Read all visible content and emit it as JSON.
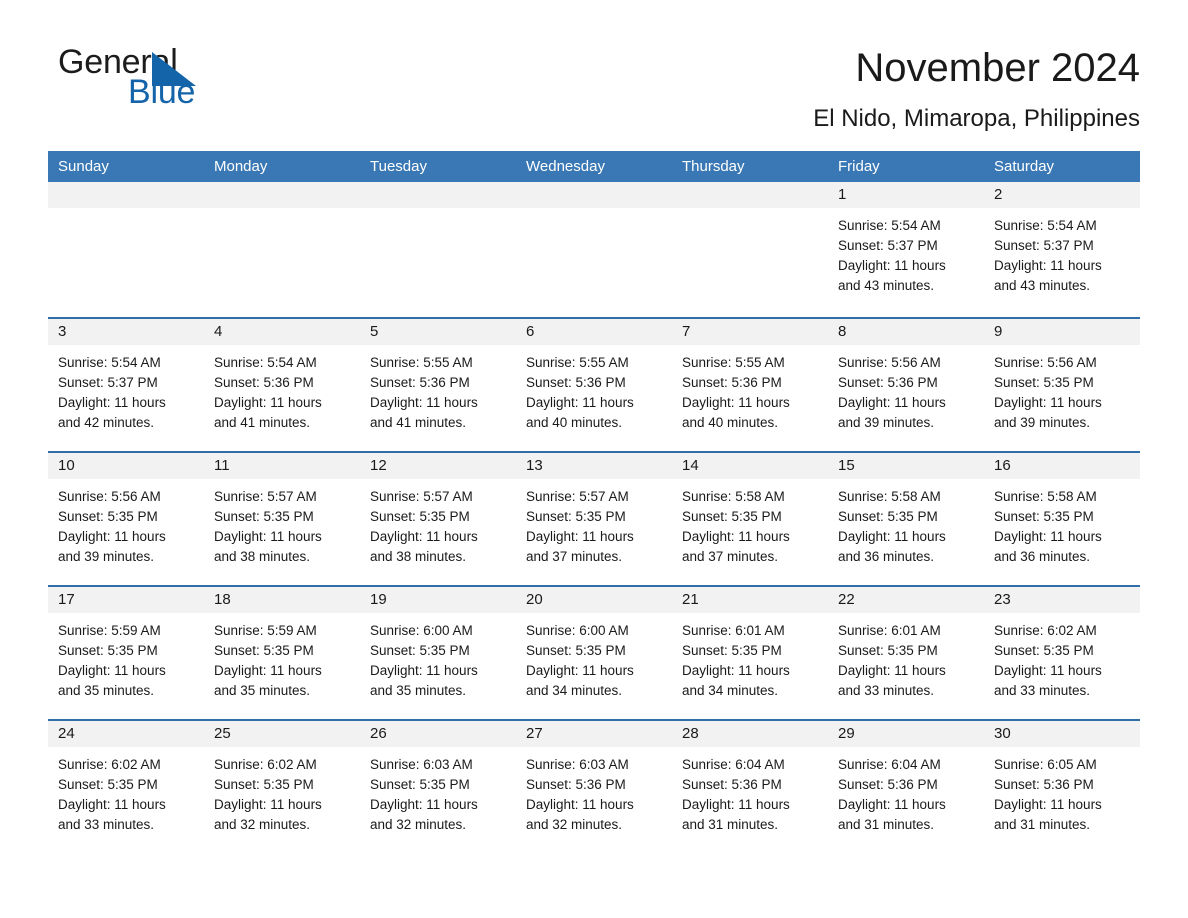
{
  "brand": {
    "word_one": "General",
    "word_two": "Blue",
    "triangle_color": "#1464aa"
  },
  "header": {
    "month_title": "November 2024",
    "location": "El Nido, Mimaropa, Philippines"
  },
  "theme": {
    "header_blue": "#3a78b5",
    "row_rule_blue": "#2f6ea8",
    "day_head_gray": "#f2f2f2",
    "text": "#1a1a1a"
  },
  "weekdays": [
    "Sunday",
    "Monday",
    "Tuesday",
    "Wednesday",
    "Thursday",
    "Friday",
    "Saturday"
  ],
  "labels": {
    "sunrise_prefix": "Sunrise:",
    "sunset_prefix": "Sunset:",
    "daylight_prefix": "Daylight:"
  },
  "weeks": [
    [
      {
        "date": "",
        "empty": true
      },
      {
        "date": "",
        "empty": true
      },
      {
        "date": "",
        "empty": true
      },
      {
        "date": "",
        "empty": true
      },
      {
        "date": "",
        "empty": true
      },
      {
        "date": "1",
        "sunrise": "Sunrise: 5:54 AM",
        "sunset": "Sunset: 5:37 PM",
        "daylight_line1": "Daylight: 11 hours",
        "daylight_line2": "and 43 minutes."
      },
      {
        "date": "2",
        "sunrise": "Sunrise: 5:54 AM",
        "sunset": "Sunset: 5:37 PM",
        "daylight_line1": "Daylight: 11 hours",
        "daylight_line2": "and 43 minutes."
      }
    ],
    [
      {
        "date": "3",
        "sunrise": "Sunrise: 5:54 AM",
        "sunset": "Sunset: 5:37 PM",
        "daylight_line1": "Daylight: 11 hours",
        "daylight_line2": "and 42 minutes."
      },
      {
        "date": "4",
        "sunrise": "Sunrise: 5:54 AM",
        "sunset": "Sunset: 5:36 PM",
        "daylight_line1": "Daylight: 11 hours",
        "daylight_line2": "and 41 minutes."
      },
      {
        "date": "5",
        "sunrise": "Sunrise: 5:55 AM",
        "sunset": "Sunset: 5:36 PM",
        "daylight_line1": "Daylight: 11 hours",
        "daylight_line2": "and 41 minutes."
      },
      {
        "date": "6",
        "sunrise": "Sunrise: 5:55 AM",
        "sunset": "Sunset: 5:36 PM",
        "daylight_line1": "Daylight: 11 hours",
        "daylight_line2": "and 40 minutes."
      },
      {
        "date": "7",
        "sunrise": "Sunrise: 5:55 AM",
        "sunset": "Sunset: 5:36 PM",
        "daylight_line1": "Daylight: 11 hours",
        "daylight_line2": "and 40 minutes."
      },
      {
        "date": "8",
        "sunrise": "Sunrise: 5:56 AM",
        "sunset": "Sunset: 5:36 PM",
        "daylight_line1": "Daylight: 11 hours",
        "daylight_line2": "and 39 minutes."
      },
      {
        "date": "9",
        "sunrise": "Sunrise: 5:56 AM",
        "sunset": "Sunset: 5:35 PM",
        "daylight_line1": "Daylight: 11 hours",
        "daylight_line2": "and 39 minutes."
      }
    ],
    [
      {
        "date": "10",
        "sunrise": "Sunrise: 5:56 AM",
        "sunset": "Sunset: 5:35 PM",
        "daylight_line1": "Daylight: 11 hours",
        "daylight_line2": "and 39 minutes."
      },
      {
        "date": "11",
        "sunrise": "Sunrise: 5:57 AM",
        "sunset": "Sunset: 5:35 PM",
        "daylight_line1": "Daylight: 11 hours",
        "daylight_line2": "and 38 minutes."
      },
      {
        "date": "12",
        "sunrise": "Sunrise: 5:57 AM",
        "sunset": "Sunset: 5:35 PM",
        "daylight_line1": "Daylight: 11 hours",
        "daylight_line2": "and 38 minutes."
      },
      {
        "date": "13",
        "sunrise": "Sunrise: 5:57 AM",
        "sunset": "Sunset: 5:35 PM",
        "daylight_line1": "Daylight: 11 hours",
        "daylight_line2": "and 37 minutes."
      },
      {
        "date": "14",
        "sunrise": "Sunrise: 5:58 AM",
        "sunset": "Sunset: 5:35 PM",
        "daylight_line1": "Daylight: 11 hours",
        "daylight_line2": "and 37 minutes."
      },
      {
        "date": "15",
        "sunrise": "Sunrise: 5:58 AM",
        "sunset": "Sunset: 5:35 PM",
        "daylight_line1": "Daylight: 11 hours",
        "daylight_line2": "and 36 minutes."
      },
      {
        "date": "16",
        "sunrise": "Sunrise: 5:58 AM",
        "sunset": "Sunset: 5:35 PM",
        "daylight_line1": "Daylight: 11 hours",
        "daylight_line2": "and 36 minutes."
      }
    ],
    [
      {
        "date": "17",
        "sunrise": "Sunrise: 5:59 AM",
        "sunset": "Sunset: 5:35 PM",
        "daylight_line1": "Daylight: 11 hours",
        "daylight_line2": "and 35 minutes."
      },
      {
        "date": "18",
        "sunrise": "Sunrise: 5:59 AM",
        "sunset": "Sunset: 5:35 PM",
        "daylight_line1": "Daylight: 11 hours",
        "daylight_line2": "and 35 minutes."
      },
      {
        "date": "19",
        "sunrise": "Sunrise: 6:00 AM",
        "sunset": "Sunset: 5:35 PM",
        "daylight_line1": "Daylight: 11 hours",
        "daylight_line2": "and 35 minutes."
      },
      {
        "date": "20",
        "sunrise": "Sunrise: 6:00 AM",
        "sunset": "Sunset: 5:35 PM",
        "daylight_line1": "Daylight: 11 hours",
        "daylight_line2": "and 34 minutes."
      },
      {
        "date": "21",
        "sunrise": "Sunrise: 6:01 AM",
        "sunset": "Sunset: 5:35 PM",
        "daylight_line1": "Daylight: 11 hours",
        "daylight_line2": "and 34 minutes."
      },
      {
        "date": "22",
        "sunrise": "Sunrise: 6:01 AM",
        "sunset": "Sunset: 5:35 PM",
        "daylight_line1": "Daylight: 11 hours",
        "daylight_line2": "and 33 minutes."
      },
      {
        "date": "23",
        "sunrise": "Sunrise: 6:02 AM",
        "sunset": "Sunset: 5:35 PM",
        "daylight_line1": "Daylight: 11 hours",
        "daylight_line2": "and 33 minutes."
      }
    ],
    [
      {
        "date": "24",
        "sunrise": "Sunrise: 6:02 AM",
        "sunset": "Sunset: 5:35 PM",
        "daylight_line1": "Daylight: 11 hours",
        "daylight_line2": "and 33 minutes."
      },
      {
        "date": "25",
        "sunrise": "Sunrise: 6:02 AM",
        "sunset": "Sunset: 5:35 PM",
        "daylight_line1": "Daylight: 11 hours",
        "daylight_line2": "and 32 minutes."
      },
      {
        "date": "26",
        "sunrise": "Sunrise: 6:03 AM",
        "sunset": "Sunset: 5:35 PM",
        "daylight_line1": "Daylight: 11 hours",
        "daylight_line2": "and 32 minutes."
      },
      {
        "date": "27",
        "sunrise": "Sunrise: 6:03 AM",
        "sunset": "Sunset: 5:36 PM",
        "daylight_line1": "Daylight: 11 hours",
        "daylight_line2": "and 32 minutes."
      },
      {
        "date": "28",
        "sunrise": "Sunrise: 6:04 AM",
        "sunset": "Sunset: 5:36 PM",
        "daylight_line1": "Daylight: 11 hours",
        "daylight_line2": "and 31 minutes."
      },
      {
        "date": "29",
        "sunrise": "Sunrise: 6:04 AM",
        "sunset": "Sunset: 5:36 PM",
        "daylight_line1": "Daylight: 11 hours",
        "daylight_line2": "and 31 minutes."
      },
      {
        "date": "30",
        "sunrise": "Sunrise: 6:05 AM",
        "sunset": "Sunset: 5:36 PM",
        "daylight_line1": "Daylight: 11 hours",
        "daylight_line2": "and 31 minutes."
      }
    ]
  ]
}
